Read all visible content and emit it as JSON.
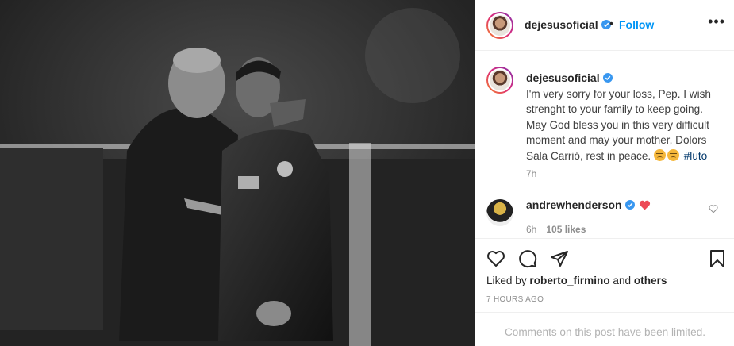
{
  "post": {
    "username": "dejesusoficial",
    "follow_label": "Follow",
    "bullet": "•",
    "more_label": "•••"
  },
  "caption": {
    "username": "dejesusoficial",
    "text": "I'm very sorry for your loss, Pep. I wish strenght to your family to keep going. May God bless you in this very difficult moment and may your mother, Dolors Sala Carrió, rest in peace.",
    "hashtag": "#luto",
    "time": "7h"
  },
  "comment": {
    "username": "andrewhenderson",
    "time": "6h",
    "likes": "105 likes"
  },
  "likes": {
    "prefix": "Liked by",
    "user": "roberto_firmino",
    "connector": "and",
    "others": "others"
  },
  "post_time": "7 HOURS AGO",
  "comments_limited": "Comments on this post have been limited.",
  "colors": {
    "link_blue": "#0095f6",
    "verified_blue": "#3897f0",
    "heart_red": "#ed4956",
    "muted": "#8e8e8e"
  },
  "icons": [
    "verified-badge-icon",
    "more-options-icon",
    "heart-icon",
    "comment-icon",
    "share-icon",
    "bookmark-icon",
    "red-heart-icon",
    "like-comment-icon"
  ]
}
